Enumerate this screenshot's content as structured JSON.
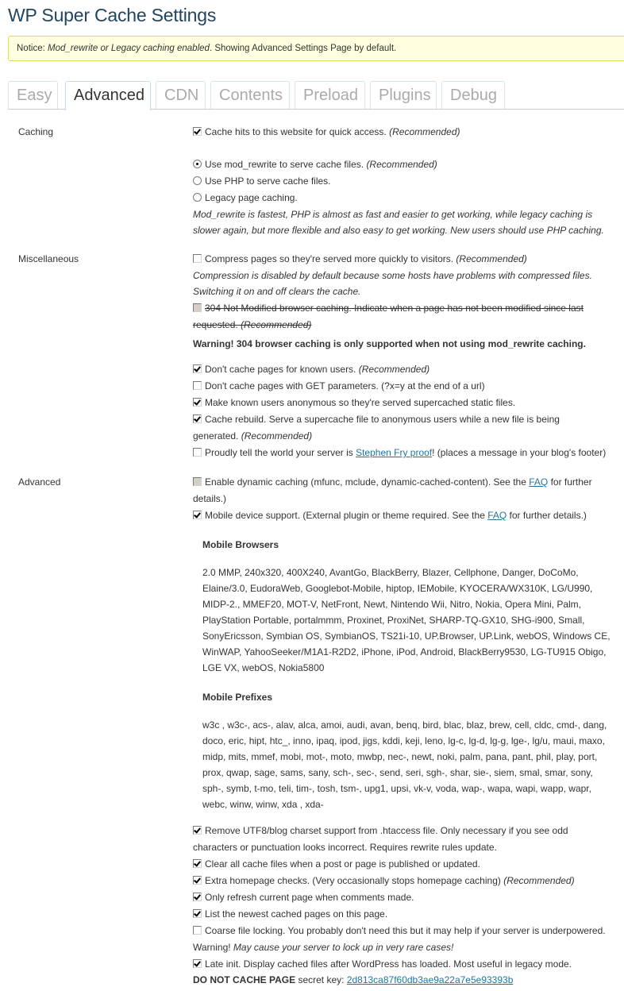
{
  "page": {
    "title": "WP Super Cache Settings"
  },
  "notice": {
    "prefix": "Notice: ",
    "emphasis": "Mod_rewrite or Legacy caching enabled",
    "suffix": ". Showing Advanced Settings Page by default."
  },
  "tabs": [
    {
      "label": "Easy",
      "active": false
    },
    {
      "label": "Advanced",
      "active": true
    },
    {
      "label": "CDN",
      "active": false
    },
    {
      "label": "Contents",
      "active": false
    },
    {
      "label": "Preload",
      "active": false
    },
    {
      "label": "Plugins",
      "active": false
    },
    {
      "label": "Debug",
      "active": false
    }
  ],
  "caching": {
    "label": "Caching",
    "cache_hits": {
      "text": "Cache hits to this website for quick access.",
      "note": "(Recommended)",
      "checked": true
    },
    "modes": [
      {
        "text": "Use mod_rewrite to serve cache files.",
        "note": "(Recommended)",
        "selected": true
      },
      {
        "text": "Use PHP to serve cache files.",
        "note": "",
        "selected": false
      },
      {
        "text": "Legacy page caching.",
        "note": "",
        "selected": false
      }
    ],
    "description_line1": "Mod_rewrite is fastest, PHP is almost as fast and easier to get working, while legacy caching is",
    "description_line2": "slower again, but more flexible and also easy to get working. New users should use PHP caching."
  },
  "misc": {
    "label": "Miscellaneous",
    "compress": {
      "text": "Compress pages so they're served more quickly to visitors.",
      "note": "(Recommended)",
      "checked": false
    },
    "compress_desc1": "Compression is disabled by default because some hosts have problems with compressed files.",
    "compress_desc2": "Switching it on and off clears the cache.",
    "not_modified_line1": "304 Not Modified browser caching. Indicate when a page has not been modified since last",
    "not_modified_line2": "requested.",
    "not_modified_note": "(Recommended)",
    "not_modified_checked": false,
    "warning_304": "Warning! 304 browser caching is only supported when not using mod_rewrite caching.",
    "known_users": {
      "text": "Don't cache pages for known users.",
      "note": "(Recommended)",
      "checked": true
    },
    "get_params": {
      "text": "Don't cache pages with GET parameters. (?x=y at the end of a url)",
      "checked": false
    },
    "anonymous": {
      "text": "Make known users anonymous so they're served supercached static files.",
      "checked": true
    },
    "rebuild_line1": "Cache rebuild. Serve a supercache file to anonymous users while a new file is being",
    "rebuild_line2": "generated.",
    "rebuild_note": "(Recommended)",
    "rebuild_checked": true,
    "fry_prefix": "Proudly tell the world your server is ",
    "fry_link": "Stephen Fry proof",
    "fry_suffix": "! (places a message in your blog's footer)",
    "fry_checked": false
  },
  "advanced": {
    "label": "Advanced",
    "dynamic_prefix": "Enable dynamic caching (mfunc, mclude, dynamic-cached-content). See the ",
    "dynamic_link": "FAQ",
    "dynamic_suffix": " for further",
    "dynamic_line2": "details.)",
    "dynamic_checked": false,
    "mobile_prefix": "Mobile device support. (External plugin or theme required. See the ",
    "mobile_link": "FAQ",
    "mobile_suffix": " for further details.)",
    "mobile_checked": true,
    "mobile_browsers_title": "Mobile Browsers",
    "mobile_browsers": "2.0 MMP, 240x320, 400X240, AvantGo, BlackBerry, Blazer, Cellphone, Danger, DoCoMo, Elaine/3.0, EudoraWeb, Googlebot-Mobile, hiptop, IEMobile, KYOCERA/WX310K, LG/U990, MIDP-2., MMEF20, MOT-V, NetFront, Newt, Nintendo Wii, Nitro, Nokia, Opera Mini, Palm, PlayStation Portable, portalmmm, Proxinet, ProxiNet, SHARP-TQ-GX10, SHG-i900, Small, SonyEricsson, Symbian OS, SymbianOS, TS21i-10, UP.Browser, UP.Link, webOS, Windows CE, WinWAP, YahooSeeker/M1A1-R2D2, iPhone, iPod, Android, BlackBerry9530, LG-TU915 Obigo, LGE VX, webOS, Nokia5800",
    "mobile_prefixes_title": "Mobile Prefixes",
    "mobile_prefixes": "w3c , w3c-, acs-, alav, alca, amoi, audi, avan, benq, bird, blac, blaz, brew, cell, cldc, cmd-, dang, doco, eric, hipt, htc_, inno, ipaq, ipod, jigs, kddi, keji, leno, lg-c, lg-d, lg-g, lge-, lg/u, maui, maxo, midp, mits, mmef, mobi, mot-, moto, mwbp, nec-, newt, noki, palm, pana, pant, phil, play, port, prox, qwap, sage, sams, sany, sch-, sec-, send, seri, sgh-, shar, sie-, siem, smal, smar, sony, sph-, symb, t-mo, teli, tim-, tosh, tsm-, upg1, upsi, vk-v, voda, wap-, wapa, wapi, wapp, wapr, webc, winw, winw, xda , xda-",
    "utf8_line1": "Remove UTF8/blog charset support from .htaccess file. Only necessary if you see odd",
    "utf8_line2": "characters or punctuation looks incorrect. Requires rewrite rules update.",
    "utf8_checked": true,
    "clear_all": {
      "text": "Clear all cache files when a post or page is published or updated.",
      "checked": true
    },
    "homepage": {
      "text": "Extra homepage checks. (Very occasionally stops homepage caching)",
      "note": "(Recommended)",
      "checked": true
    },
    "refresh": {
      "text": "Only refresh current page when comments made.",
      "checked": true
    },
    "list_newest": {
      "text": "List the newest cached pages on this page.",
      "checked": true
    },
    "coarse": {
      "text": "Coarse file locking. You probably don't need this but it may help if your server is underpowered.",
      "checked": false
    },
    "coarse_warning_prefix": "Warning! ",
    "coarse_warning": "May cause your server to lock up in very rare cases!",
    "late_init": {
      "text": "Late init. Display cached files after WordPress has loaded. Most useful in legacy mode.",
      "checked": true
    },
    "secret_label": "DO NOT CACHE PAGE",
    "secret_mid": " secret key: ",
    "secret_key": "2d813ca87f60db3ae9a22a7e5e93393b"
  }
}
